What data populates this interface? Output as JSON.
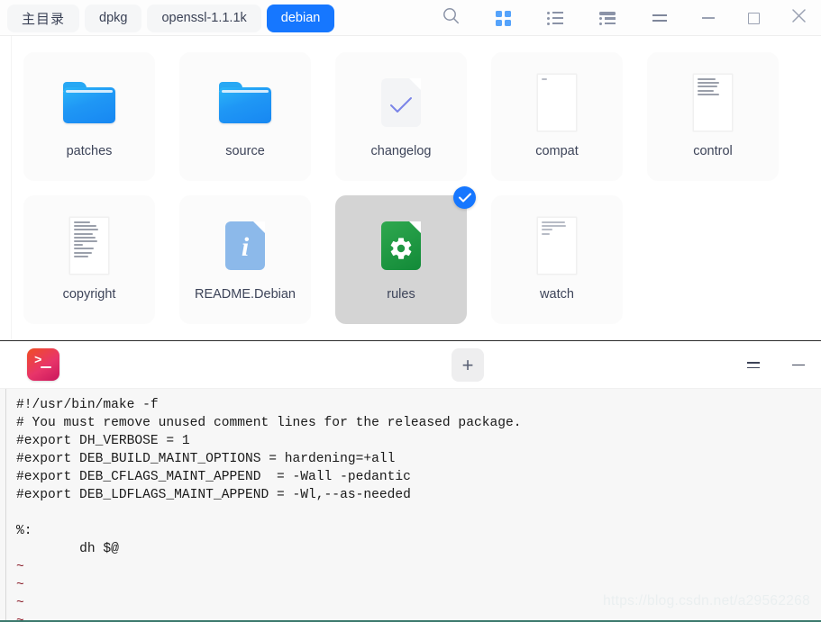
{
  "window": {
    "tabs": [
      {
        "label": "主目录",
        "active": false,
        "cjk": true
      },
      {
        "label": "dpkg",
        "active": false,
        "cjk": false
      },
      {
        "label": "openssl-1.1.1k",
        "active": false,
        "cjk": false
      },
      {
        "label": "debian",
        "active": true,
        "cjk": false
      }
    ],
    "toolbar": {
      "search": "search-icon",
      "grid_view": "grid-view-icon",
      "list_view": "list-view-icon",
      "detail_view": "detail-view-icon",
      "menu": "hamburger-menu-icon",
      "minimize": "minimize-icon",
      "maximize": "maximize-icon",
      "close": "close-icon"
    },
    "accent_color": "#1677ff",
    "active_view": "grid"
  },
  "files": {
    "row1": [
      {
        "name": "patches",
        "icon": "folder",
        "selected": false
      },
      {
        "name": "source",
        "icon": "folder",
        "selected": false
      },
      {
        "name": "changelog",
        "icon": "doc-check",
        "selected": false
      },
      {
        "name": "compat",
        "icon": "doc-text",
        "selected": false
      },
      {
        "name": "control",
        "icon": "doc-text-dense",
        "selected": false
      }
    ],
    "row2": [
      {
        "name": "copyright",
        "icon": "doc-text-dense",
        "selected": false
      },
      {
        "name": "README.Debian",
        "icon": "doc-info",
        "selected": false
      },
      {
        "name": "rules",
        "icon": "doc-gear",
        "selected": true
      },
      {
        "name": "watch",
        "icon": "doc-text",
        "selected": false
      }
    ]
  },
  "terminal": {
    "app_icon": "terminal-icon",
    "new_tab_label": "+",
    "menu_icon": "hamburger-menu-icon",
    "minimize_icon": "minimize-icon",
    "content": "#!/usr/bin/make -f\n# You must remove unused comment lines for the released package.\n#export DH_VERBOSE = 1\n#export DEB_BUILD_MAINT_OPTIONS = hardening=+all\n#export DEB_CFLAGS_MAINT_APPEND  = -Wall -pedantic\n#export DEB_LDFLAGS_MAINT_APPEND = -Wl,--as-needed\n\n%:\n\tdh $@",
    "empty_markers": [
      "~",
      "~",
      "~",
      "~"
    ]
  },
  "watermark": {
    "text": "https://blog.csdn.net/a29562268"
  }
}
